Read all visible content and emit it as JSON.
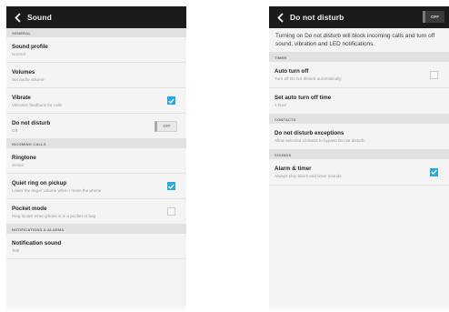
{
  "left": {
    "title": "Sound",
    "sections": {
      "general": "General",
      "incoming_calls": "Incoming calls",
      "notifications": "Notifications & alarms"
    },
    "items": {
      "sound_profile": {
        "title": "Sound profile",
        "subtitle": "Normal"
      },
      "volumes": {
        "title": "Volumes",
        "subtitle": "Set audio volume"
      },
      "vibrate": {
        "title": "Vibrate",
        "subtitle": "Vibration feedback for calls",
        "checked": true
      },
      "do_not_disturb": {
        "title": "Do not disturb",
        "subtitle": "Off",
        "switch_label": "OFF"
      },
      "ringtone": {
        "title": "Ringtone",
        "subtitle": "Sense"
      },
      "quiet_ring": {
        "title": "Quiet ring on pickup",
        "subtitle": "Lower the ringer volume when I move the phone",
        "checked": true
      },
      "pocket_mode": {
        "title": "Pocket mode",
        "subtitle": "Ring louder when phone is in a pocket or bag",
        "checked": false
      },
      "notification_sound": {
        "title": "Notification sound",
        "subtitle": "Tesl"
      }
    }
  },
  "right": {
    "title": "Do not disturb",
    "title_switch_label": "OFF",
    "intro": "Turning on Do not disturb will block incoming calls and turn off sound, vibration and LED notifications.",
    "sections": {
      "timer": "Timer",
      "contacts": "Contacts",
      "sounds": "Sounds"
    },
    "items": {
      "auto_turn_off": {
        "title": "Auto turn off",
        "subtitle": "Turn off Do not disturb automatically",
        "checked": false
      },
      "set_auto_turn_off_time": {
        "title": "Set auto turn off time",
        "subtitle": "1 hour"
      },
      "exceptions": {
        "title": "Do not disturb exceptions",
        "subtitle": "Allow selected contacts to bypass Do not disturb"
      },
      "alarm_timer": {
        "title": "Alarm & timer",
        "subtitle": "Always play alarm and timer sounds",
        "checked": true
      }
    }
  },
  "colors": {
    "accent": "#2aa9e0",
    "titlebar": "#1b1b1b",
    "section": "#e1e1e1",
    "background": "#f3f3f3"
  },
  "icons": {
    "back": "chevron-left-icon",
    "check": "checkmark-icon"
  }
}
